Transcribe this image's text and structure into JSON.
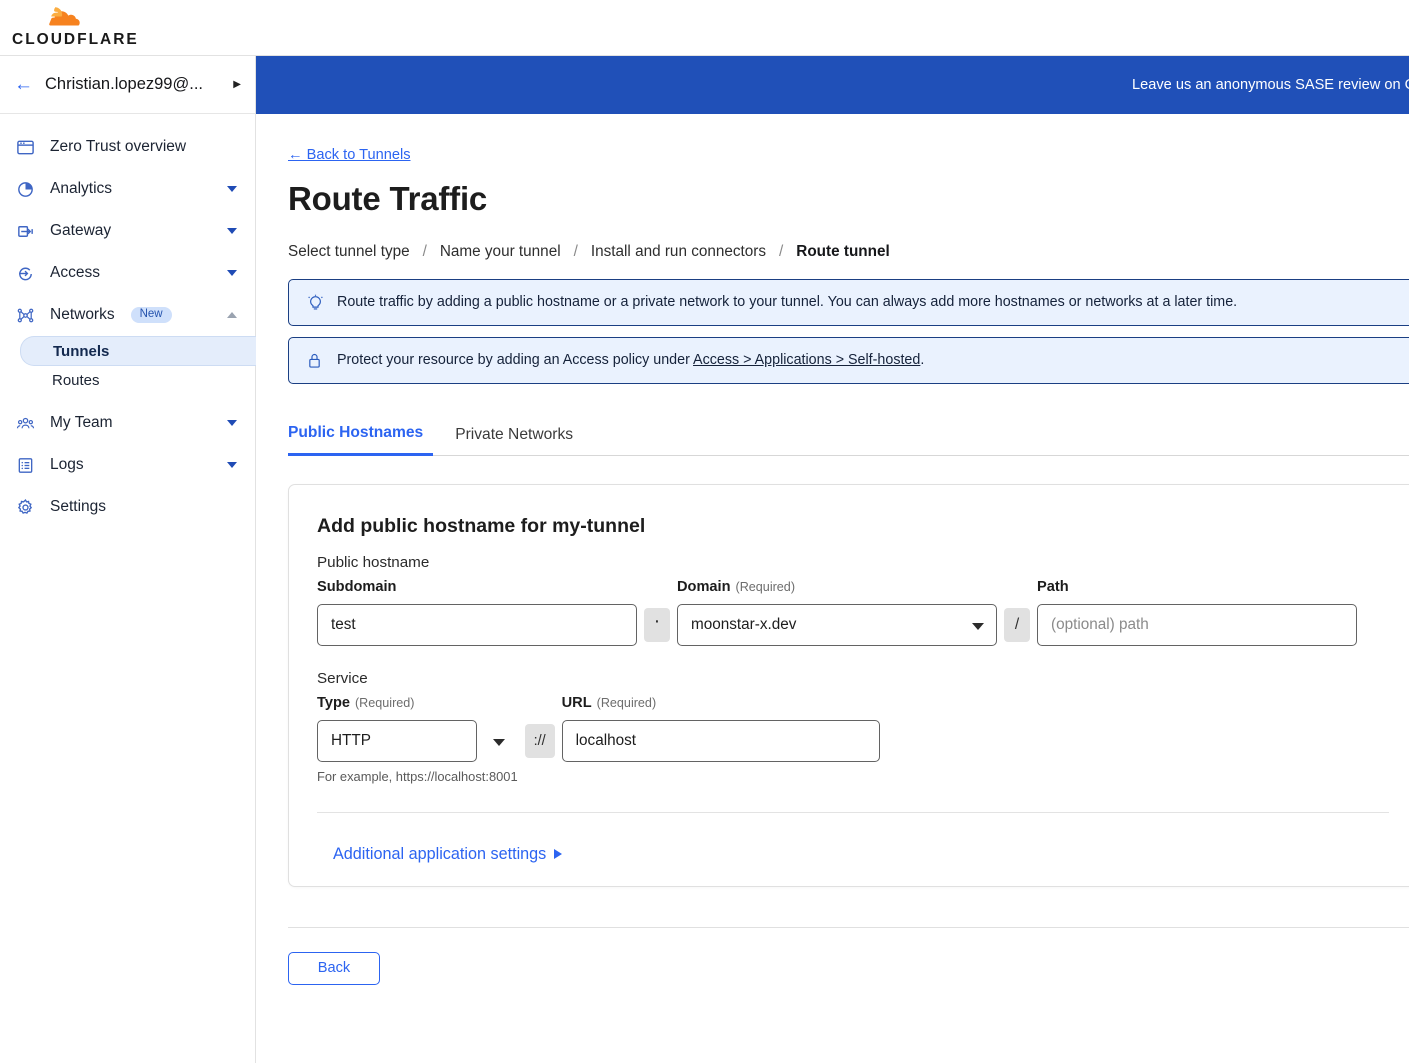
{
  "brand": {
    "name": "CLOUDFLARE",
    "logo_icon": "cloudflare-cloud-icon"
  },
  "account": {
    "back_icon": "arrow-left-icon",
    "name": "Christian.lopez99@...",
    "caret_icon": "chevron-right-icon"
  },
  "sidebar": {
    "items": [
      {
        "label": "Zero Trust overview",
        "icon": "window-icon",
        "expandable": false
      },
      {
        "label": "Analytics",
        "icon": "pie-chart-icon",
        "expandable": true
      },
      {
        "label": "Gateway",
        "icon": "gateway-arrow-icon",
        "expandable": true
      },
      {
        "label": "Access",
        "icon": "access-arrow-icon",
        "expandable": true
      },
      {
        "label": "Networks",
        "icon": "network-nodes-icon",
        "expandable": true,
        "badge": "New",
        "expanded": true
      },
      {
        "label": "My Team",
        "icon": "people-icon",
        "expandable": true
      },
      {
        "label": "Logs",
        "icon": "list-document-icon",
        "expandable": true
      },
      {
        "label": "Settings",
        "icon": "gear-icon",
        "expandable": false
      }
    ],
    "networks_children": [
      {
        "label": "Tunnels",
        "active": true
      },
      {
        "label": "Routes",
        "active": false
      }
    ]
  },
  "banner": {
    "text": "Leave us an anonymous SASE review on Gart"
  },
  "page": {
    "back_link": "← Back to Tunnels",
    "title": "Route Traffic"
  },
  "breadcrumbs": [
    {
      "label": "Select tunnel type",
      "current": false
    },
    {
      "label": "Name your tunnel",
      "current": false
    },
    {
      "label": "Install and run connectors",
      "current": false
    },
    {
      "label": "Route tunnel",
      "current": true
    }
  ],
  "breadcrumb_separator": "/",
  "alerts": [
    {
      "icon": "lightbulb-icon",
      "text": "Route traffic by adding a public hostname or a private network to your tunnel. You can always add more hostnames or networks at a later time."
    },
    {
      "icon": "lock-icon",
      "text_before": "Protect your resource by adding an Access policy under ",
      "link": "Access > Applications > Self-hosted",
      "text_after": "."
    }
  ],
  "tabs": [
    {
      "label": "Public Hostnames",
      "active": true
    },
    {
      "label": "Private Networks",
      "active": false
    }
  ],
  "form": {
    "card_title": "Add public hostname for my-tunnel",
    "public_hostname_label": "Public hostname",
    "subdomain": {
      "label": "Subdomain",
      "required_note": "",
      "value": "test",
      "placeholder": ""
    },
    "dot_separator": "·",
    "domain": {
      "label": "Domain",
      "required_note": "(Required)",
      "value": "moonstar-x.dev"
    },
    "slash_separator": "/",
    "path": {
      "label": "Path",
      "required_note": "",
      "value": "",
      "placeholder": "(optional) path"
    },
    "service_label": "Service",
    "type": {
      "label": "Type",
      "required_note": "(Required)",
      "value": "HTTP"
    },
    "protocol_separator": "://",
    "url": {
      "label": "URL",
      "required_note": "(Required)",
      "value": "localhost",
      "placeholder": ""
    },
    "url_helper": "For example, https://localhost:8001",
    "additional_settings": "Additional application settings"
  },
  "footer": {
    "back_button": "Back"
  },
  "colors": {
    "banner_blue": "#2050b8",
    "link_blue": "#2c64f1",
    "alert_bg": "#eaf2fe",
    "alert_border": "#1b3f83",
    "sidebar_active_bg": "#e4edfb",
    "badge_bg": "#cfe0fb",
    "cloudflare_orange": "#f6821f"
  }
}
